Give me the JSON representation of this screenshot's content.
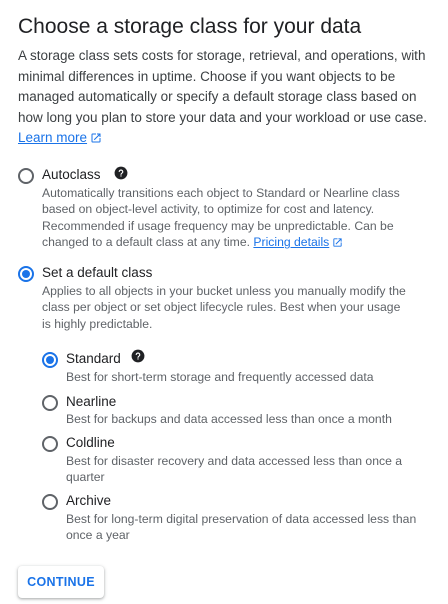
{
  "title": "Choose a storage class for your data",
  "intro": {
    "text": "A storage class sets costs for storage, retrieval, and operations, with minimal differences in uptime. Choose if you want objects to be managed automatically or specify a default storage class based on how long you plan to store your data and your workload or use case.",
    "learn_more": "Learn more"
  },
  "autoclass": {
    "label": "Autoclass",
    "selected": false,
    "description": "Automatically transitions each object to Standard or Nearline class based on object-level activity, to optimize for cost and latency. Recommended if usage frequency may be unpredictable. Can be changed to a default class at any time.",
    "pricing_link": "Pricing details"
  },
  "default_class": {
    "label": "Set a default class",
    "selected": true,
    "description": "Applies to all objects in your bucket unless you manually modify the class per object or set object lifecycle rules. Best when your usage is highly predictable."
  },
  "classes": [
    {
      "label": "Standard",
      "selected": true,
      "description": "Best for short-term storage and frequently accessed data"
    },
    {
      "label": "Nearline",
      "selected": false,
      "description": "Best for backups and data accessed less than once a month"
    },
    {
      "label": "Coldline",
      "selected": false,
      "description": "Best for disaster recovery and data accessed less than once a quarter"
    },
    {
      "label": "Archive",
      "selected": false,
      "description": "Best for long-term digital preservation of data accessed less than once a year"
    }
  ],
  "continue_label": "CONTINUE",
  "icons": {
    "help": "help-icon",
    "external_link": "external-link-icon"
  },
  "colors": {
    "accent": "#1a73e8",
    "text": "#202124",
    "secondary_text": "#5f6368"
  }
}
